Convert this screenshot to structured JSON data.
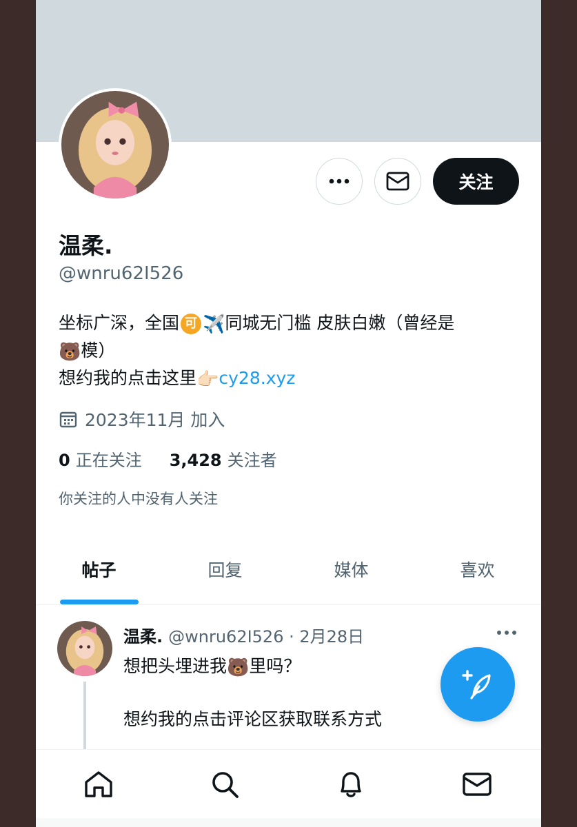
{
  "profile": {
    "name": "温柔.",
    "handle": "@wnru62I526",
    "follow_label": "关注",
    "bio_line1_a": "坐标广深，全国",
    "bio_badge": "可",
    "bio_line1_b": "同城无门槛  皮肤白嫩（曾经是",
    "bio_line2": "模）",
    "bio_line3": "想约我的点击这里",
    "bio_link": "cy28.xyz",
    "joined": "2023年11月 加入",
    "following_count": "0",
    "following_label": "正在关注",
    "followers_count": "3,428",
    "followers_label": "关注者",
    "followed_by": "你关注的人中没有人关注"
  },
  "tabs": [
    {
      "label": "帖子"
    },
    {
      "label": "回复"
    },
    {
      "label": "媒体"
    },
    {
      "label": "喜欢"
    }
  ],
  "post": {
    "author": "温柔.",
    "meta": "@wnru62I526 · 2月28日",
    "text_a": "想把头埋进我",
    "text_b": "里吗？",
    "text2": "想约我的点击评论区获取联系方式"
  },
  "icons": {
    "more": "more-horizontal-icon",
    "mail": "mail-icon",
    "calendar": "calendar-icon",
    "compose": "compose-feather-icon",
    "home": "home-icon",
    "search": "search-icon",
    "notifications": "bell-icon",
    "messages": "mail-icon"
  },
  "colors": {
    "accent": "#1d9bf0",
    "banner": "#cfd9de",
    "follow_button": "#0f1419"
  }
}
